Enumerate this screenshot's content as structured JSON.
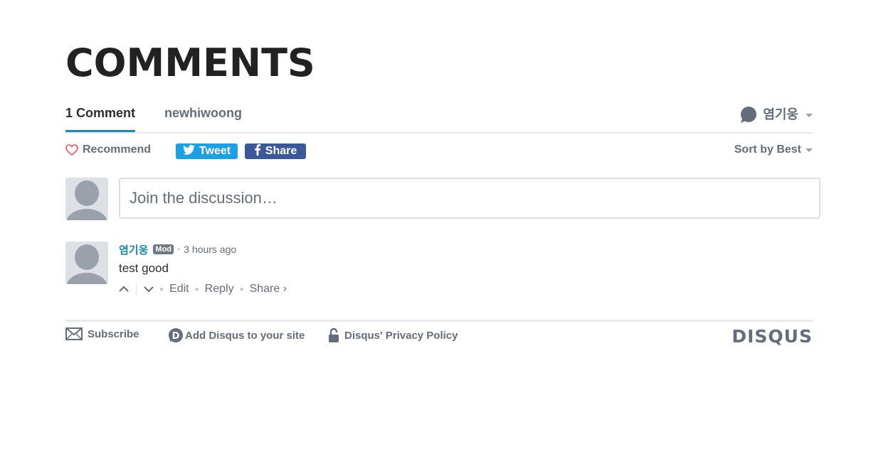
{
  "title": "COMMENTS",
  "nav": {
    "comments_tab": "1 Comment",
    "forum_tab": "newhiwoong",
    "user_name": "염기웅"
  },
  "actions": {
    "recommend": "Recommend",
    "tweet": "Tweet",
    "share": "Share",
    "sort": "Sort by Best"
  },
  "composer": {
    "placeholder": "Join the discussion…"
  },
  "comments": [
    {
      "author": "염기웅",
      "badge": "Mod",
      "timestamp": "3 hours ago",
      "body": "test good",
      "footer": {
        "edit": "Edit",
        "reply": "Reply",
        "share": "Share ›"
      }
    }
  ],
  "footer": {
    "subscribe": "Subscribe",
    "add_disqus": "Add Disqus to your site",
    "privacy": "Disqus' Privacy Policy",
    "logo": "DISQUS"
  },
  "colors": {
    "accent": "#1e88b8",
    "twitter": "#1ca0e3",
    "facebook": "#3b5998",
    "muted": "#656c7a"
  },
  "icons": {
    "recommend": "heart-icon",
    "tweet": "twitter-bird-icon",
    "share": "facebook-f-icon",
    "subscribe": "envelope-icon",
    "add_disqus": "disqus-d-icon",
    "privacy": "lock-icon",
    "user": "speech-bubble-icon",
    "upvote": "chevron-up-icon",
    "downvote": "chevron-down-icon"
  }
}
